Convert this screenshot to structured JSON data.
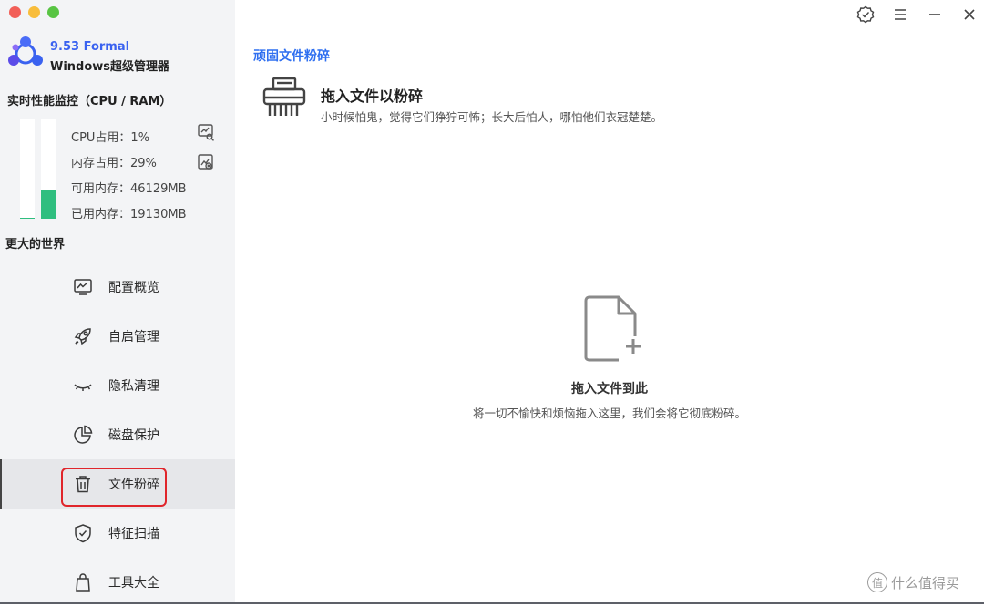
{
  "app": {
    "version": "9.53 Formal",
    "name": "Windows超级管理器"
  },
  "performance": {
    "title": "实时性能监控（CPU / RAM）",
    "cpu_label": "CPU占用：1%",
    "mem_label": "内存占用：29%",
    "available_label": "可用内存：46129MB",
    "used_label": "已用内存：19130MB",
    "cpu_percent": 1,
    "mem_percent": 29
  },
  "world": {
    "title": "更大的世界"
  },
  "nav": {
    "items": [
      {
        "label": "配置概览",
        "icon": "monitor-chart-icon"
      },
      {
        "label": "自启管理",
        "icon": "rocket-icon"
      },
      {
        "label": "隐私清理",
        "icon": "closed-eye-icon"
      },
      {
        "label": "磁盘保护",
        "icon": "pie-chart-icon"
      },
      {
        "label": "文件粉碎",
        "icon": "trash-icon"
      },
      {
        "label": "特征扫描",
        "icon": "shield-check-icon"
      },
      {
        "label": "工具大全",
        "icon": "bag-icon"
      }
    ],
    "active_index": 4
  },
  "main": {
    "breadcrumb": "顽固文件粉碎",
    "header_title": "拖入文件以粉碎",
    "header_subtitle": "小时候怕鬼，觉得它们狰狞可怖；长大后怕人，哪怕他们衣冠楚楚。",
    "drop_title": "拖入文件到此",
    "drop_subtitle": "将一切不愉快和烦恼拖入这里，我们会将它彻底粉碎。"
  },
  "watermark": {
    "badge": "值",
    "text": "什么值得买"
  },
  "colors": {
    "accent_blue": "#2f6ff0",
    "bar_green": "#2fbe7f",
    "highlight_red": "#e0252b",
    "sidebar_bg": "#f3f4f6"
  }
}
